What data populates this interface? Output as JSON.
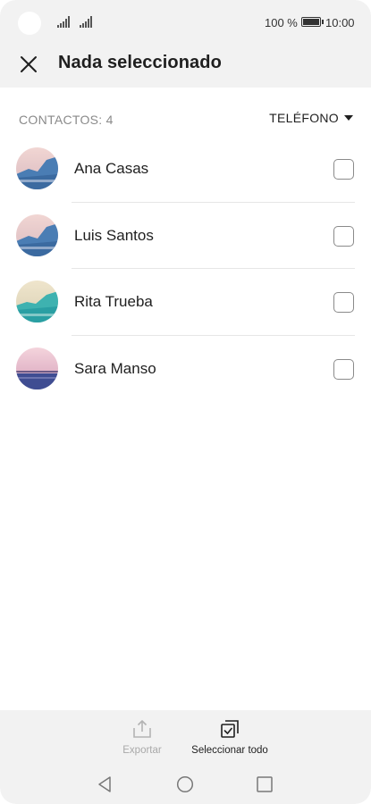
{
  "status_bar": {
    "battery": "100 %",
    "time": "10:00"
  },
  "app_bar": {
    "title": "Nada seleccionado"
  },
  "list_header": {
    "count_label": "CONTACTOS: 4",
    "source_label": "TELÉFONO"
  },
  "contacts": [
    {
      "name": "Ana Casas",
      "checked": false,
      "avatar_colors": [
        "#e9c8c8",
        "#3f6fa8"
      ]
    },
    {
      "name": "Luis Santos",
      "checked": false,
      "avatar_colors": [
        "#e9c8c8",
        "#3f6fa8"
      ]
    },
    {
      "name": "Rita Trueba",
      "checked": false,
      "avatar_colors": [
        "#e8dcc0",
        "#2aa3a6"
      ]
    },
    {
      "name": "Sara Manso",
      "checked": false,
      "avatar_colors": [
        "#f0cfd8",
        "#3b4a8c"
      ]
    }
  ],
  "actions": {
    "export_label": "Exportar",
    "select_all_label": "Seleccionar todo"
  },
  "icons": {
    "close": "close-icon",
    "export": "export-icon",
    "select_all": "select-all-icon",
    "back": "back-triangle-icon",
    "home": "home-circle-icon",
    "recent": "recent-square-icon"
  }
}
